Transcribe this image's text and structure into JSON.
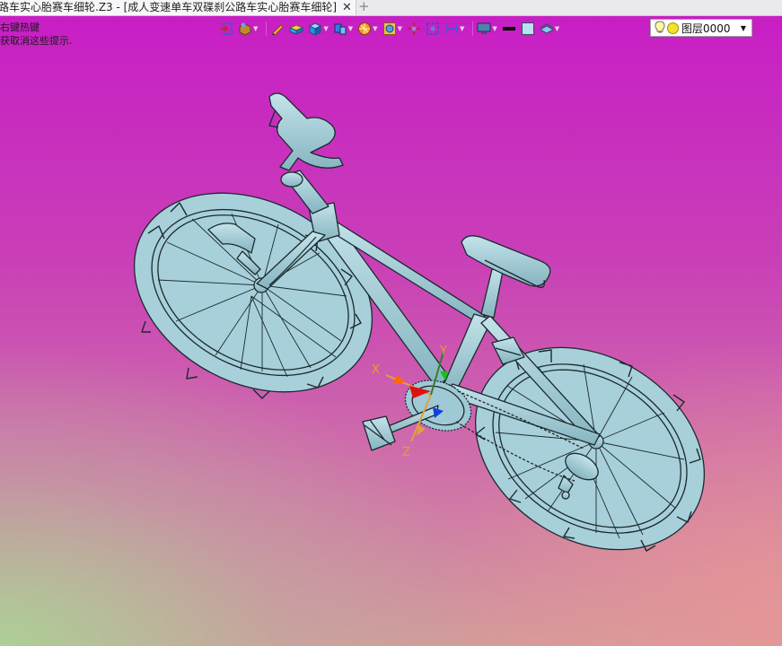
{
  "tab": {
    "title": "路车实心胎赛车细轮.Z3 - [成人变速单车双碟刹公路车实心胎赛车细轮]",
    "close_symbol": "✕",
    "new_symbol": "+"
  },
  "hint": {
    "line1": "右键热键",
    "line2": "获取消这些提示."
  },
  "toolbar": {
    "icons": [
      "exit-sketch-icon",
      "part-icon",
      "pencil-icon",
      "shaded-solid-icon",
      "cube-icon",
      "view-orient-icon",
      "render-mode-icon",
      "section-view-icon",
      "move-icon",
      "zoom-fit-icon",
      "dimension-icon",
      "display-icon",
      "line-color-icon",
      "face-color-icon",
      "layer-display-icon"
    ]
  },
  "layer": {
    "label": "图层0000",
    "indicator_color": "#f2e22a"
  },
  "axes": {
    "x": "X",
    "y": "Y",
    "z": "Z"
  },
  "colors": {
    "model": "#9fc9d4",
    "outline": "#1a2a2e",
    "bg_top": "#c81cc6",
    "bg_bottom_left": "#aad296"
  }
}
